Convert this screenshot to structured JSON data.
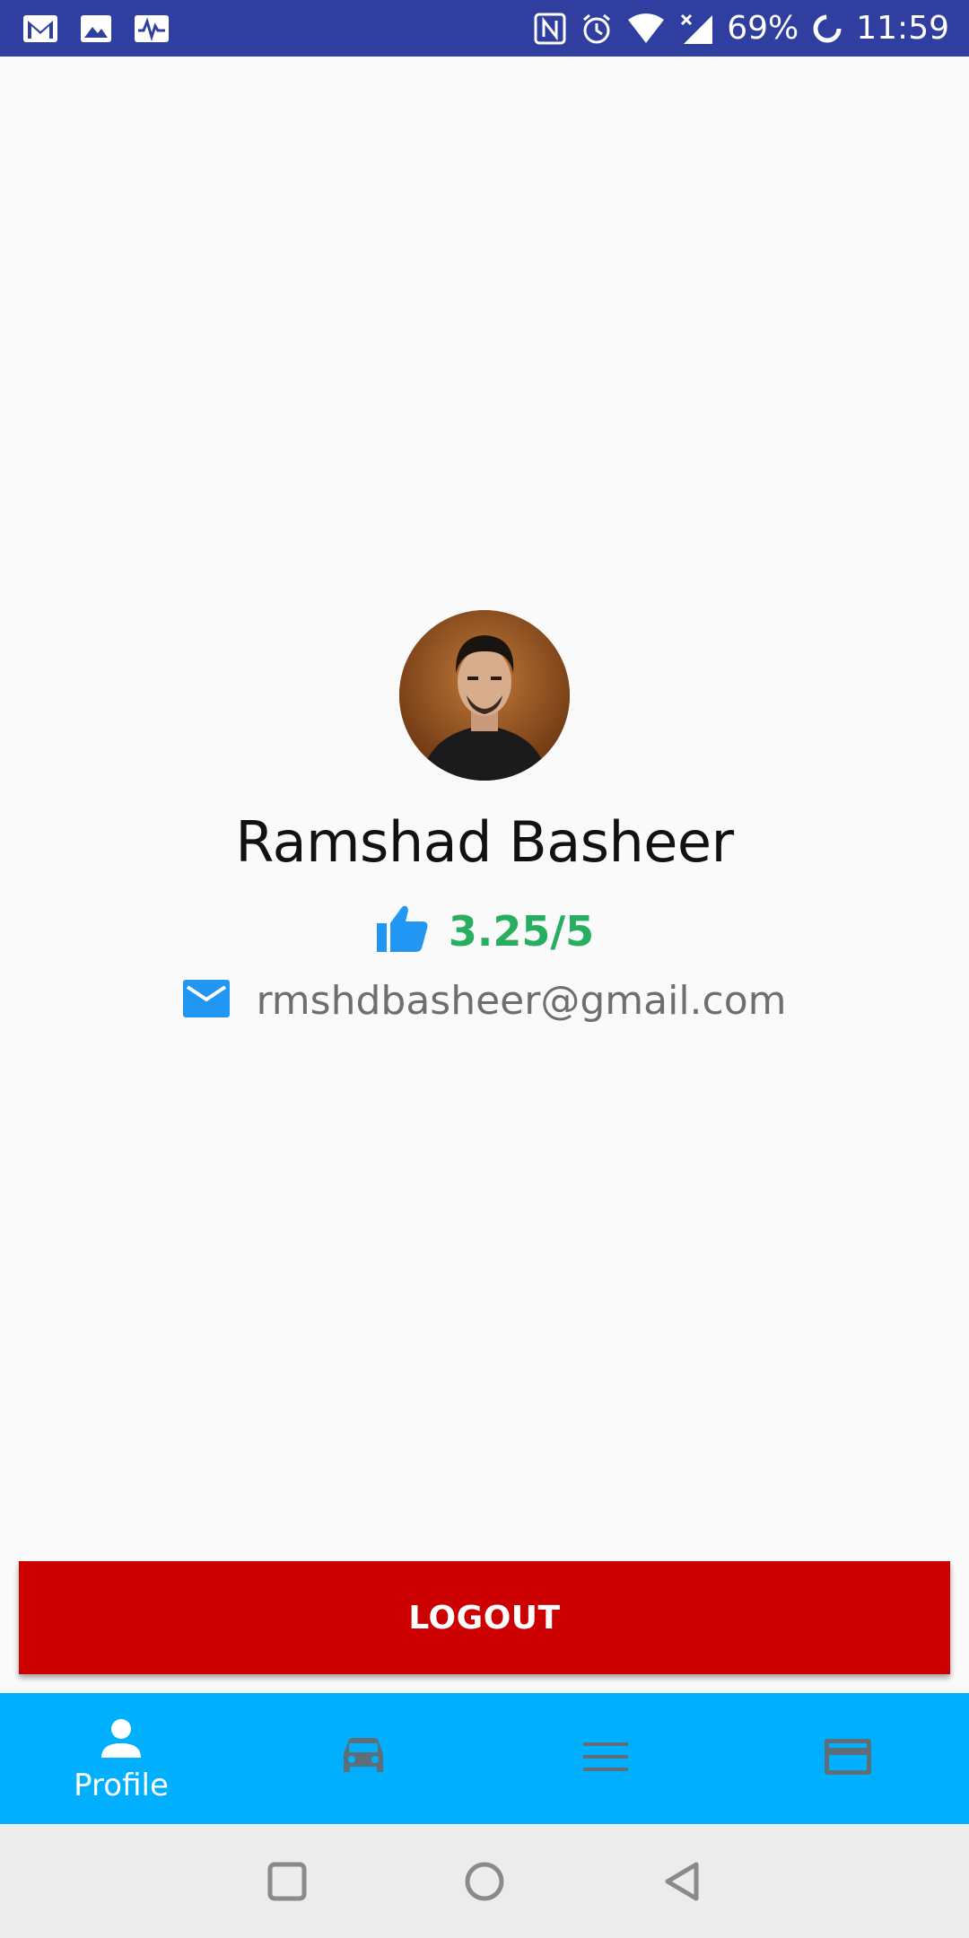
{
  "status_bar": {
    "battery": "69%",
    "time": "11:59",
    "left_icons": [
      "gmail-icon",
      "image-icon",
      "pulse-icon"
    ],
    "right_icons": [
      "nfc-icon",
      "alarm-icon",
      "wifi-icon",
      "no-signal-icon",
      "battery-saver-icon"
    ]
  },
  "profile": {
    "name": "Ramshad Basheer",
    "rating": "3.25/5",
    "email": "rmshdbasheer@gmail.com",
    "rating_icon": "thumbs-up-icon",
    "email_icon": "mail-icon"
  },
  "actions": {
    "logout_label": "LOGOUT"
  },
  "bottom_nav": {
    "items": [
      {
        "label": "Profile",
        "icon": "person-icon",
        "active": true
      },
      {
        "label": "",
        "icon": "car-icon",
        "active": false
      },
      {
        "label": "",
        "icon": "menu-icon",
        "active": false
      },
      {
        "label": "",
        "icon": "card-icon",
        "active": false
      }
    ]
  },
  "colors": {
    "status_bar": "#303f9f",
    "logout": "#cc0000",
    "bottom_nav": "#00b0ff",
    "rating": "#27ae60",
    "icon_blue": "#2196f3"
  }
}
